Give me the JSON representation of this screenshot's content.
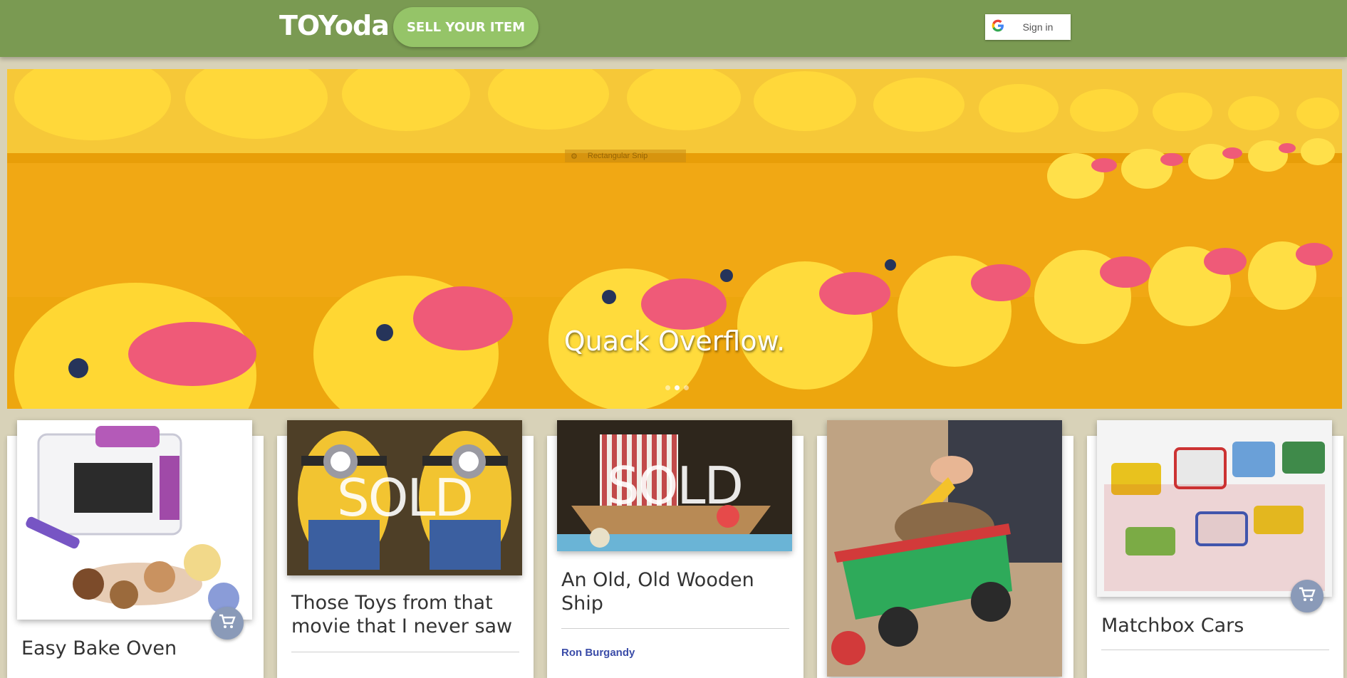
{
  "header": {
    "logo": "TOYoda",
    "sell_button": "SELL YOUR ITEM",
    "signin_label": "Sign in",
    "google_glyph": "G"
  },
  "hero": {
    "caption": "Quack Overflow.",
    "overlay_label": "Rectangular Snip",
    "slides": 3,
    "active_slide": 2
  },
  "listings": [
    {
      "title": "Easy Bake Oven",
      "sold": false,
      "seller": ""
    },
    {
      "title": "Those Toys from that movie that I never saw",
      "sold": true,
      "sold_label": "SOLD",
      "seller": ""
    },
    {
      "title": "An Old, Old Wooden Ship",
      "sold": true,
      "sold_label": "SOLD",
      "seller": "Ron Burgandy"
    },
    {
      "title": "",
      "sold": false,
      "seller": ""
    },
    {
      "title": "Matchbox Cars",
      "sold": false,
      "seller": ""
    }
  ],
  "colors": {
    "topbar": "#7a9a52",
    "sell_button": "#95c468",
    "page_bg": "#d8d2b8",
    "cart_button": "#8a9ab8",
    "seller_link": "#3b4ca8"
  },
  "icons": [
    "google-icon",
    "cart-icon",
    "snip-icon"
  ]
}
